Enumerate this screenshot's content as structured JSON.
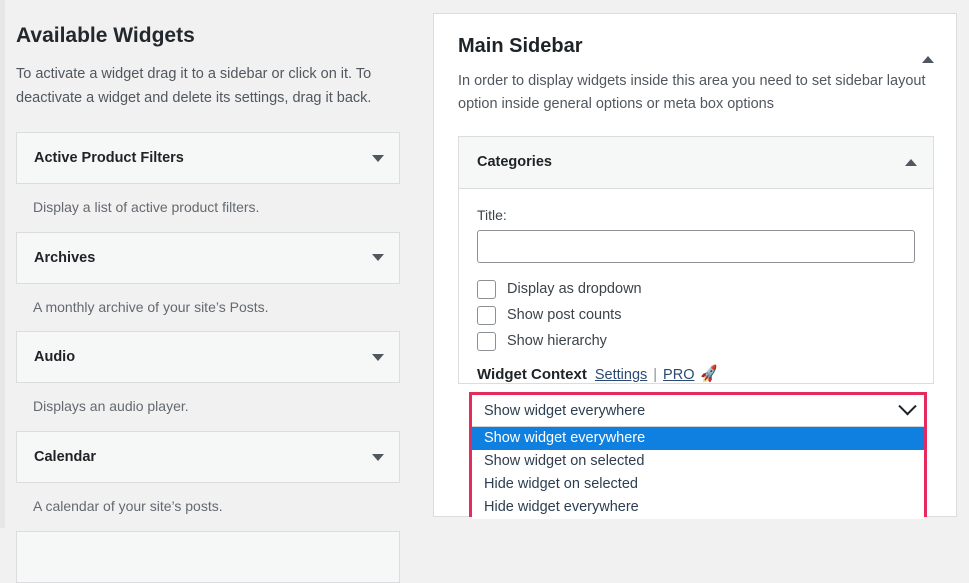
{
  "available_widgets": {
    "title": "Available Widgets",
    "description": "To activate a widget drag it to a sidebar or click on it. To deactivate a widget and delete its settings, drag it back.",
    "widgets": [
      {
        "name": "Active Product Filters",
        "description": "Display a list of active product filters.",
        "toggle_icon": "chevron-down-icon"
      },
      {
        "name": "Archives",
        "description": "A monthly archive of your site’s Posts.",
        "toggle_icon": "chevron-down-icon"
      },
      {
        "name": "Audio",
        "description": "Displays an audio player.",
        "toggle_icon": "chevron-down-icon"
      },
      {
        "name": "Calendar",
        "description": "A calendar of your site’s posts.",
        "toggle_icon": "chevron-down-icon"
      }
    ]
  },
  "main_sidebar": {
    "title": "Main Sidebar",
    "description": "In order to display widgets inside this area you need to set sidebar layout option inside general options or meta box options",
    "toggle_icon": "chevron-up-icon",
    "categories_widget": {
      "title": "Categories",
      "toggle_icon": "chevron-up-icon",
      "title_field": {
        "label": "Title:",
        "value": "",
        "placeholder": ""
      },
      "checkboxes": [
        {
          "label": "Display as dropdown",
          "checked": false
        },
        {
          "label": "Show post counts",
          "checked": false
        },
        {
          "label": "Show hierarchy",
          "checked": false
        }
      ],
      "widget_context": {
        "title": "Widget Context",
        "settings_link": "Settings",
        "separator": "|",
        "pro_link": "PRO",
        "pro_icon": "rocket-icon",
        "select": {
          "value": "Show widget everywhere",
          "dropdown_icon": "chevron-down-icon",
          "open": true,
          "options": [
            "Show widget everywhere",
            "Show widget on selected",
            "Hide widget on selected",
            "Hide widget everywhere"
          ],
          "selected_index": 0
        }
      }
    }
  },
  "colors": {
    "page_background": "#f1f1f1",
    "card_background": "#ffffff",
    "border": "#dcdcde",
    "widget_header_background": "#f6f7f7",
    "highlight_red": "#e52a5e",
    "option_selected_blue": "#0f7fe0",
    "link": "#2b4a73",
    "heading_text": "#1d2327",
    "muted_text": "#50575e"
  }
}
